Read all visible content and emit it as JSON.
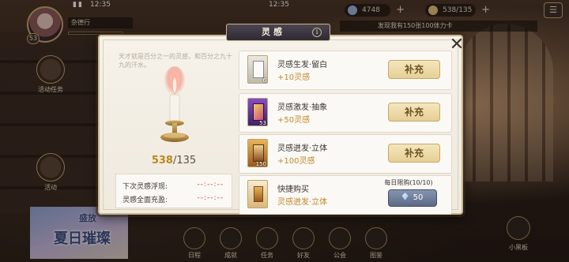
{
  "status_bar": {
    "time": "12:35",
    "center_time": "12:35"
  },
  "player": {
    "name": "杂德行",
    "level": "53"
  },
  "resources": [
    {
      "icon": "feather-icon",
      "value": "4748"
    },
    {
      "icon": "candle-icon",
      "value": "538/135"
    }
  ],
  "notice": {
    "text": "发现我有150张100体力卡"
  },
  "side": {
    "tasks_label": "活动任务",
    "activity_label": "活动",
    "banner_top": "盛放",
    "banner_title": "夏日璀璨"
  },
  "bottom_nav": [
    "日程",
    "成就",
    "任务",
    "好友",
    "公会",
    "图鉴"
  ],
  "xiaoheiban": "小黑板",
  "modal": {
    "title": "灵感",
    "flavor": "天才就是百分之一的灵感，和百分之九十九的汗水。",
    "count_current": "538",
    "count_max": "/135",
    "next_restore_label": "下次灵感浮现:",
    "next_restore_value": "--:--:--",
    "full_restore_label": "灵感全面充盈:",
    "full_restore_value": "--:--:--",
    "items": [
      {
        "name": "灵感生发·留白",
        "gain": "+10灵感",
        "qty": "6",
        "button": "补充",
        "card_color": "#f2f0ec"
      },
      {
        "name": "灵感激发·抽象",
        "gain": "+50灵感",
        "qty": "53",
        "button": "补充",
        "card_color": "#6a3c9a"
      },
      {
        "name": "灵感迸发·立体",
        "gain": "+100灵感",
        "qty": "150",
        "button": "补充",
        "card_color": "#c4872e"
      }
    ],
    "quick_buy": {
      "name": "快捷购买",
      "sub": "灵感迸发·立体",
      "limit": "每日限购(10/10)",
      "price": "50"
    }
  }
}
